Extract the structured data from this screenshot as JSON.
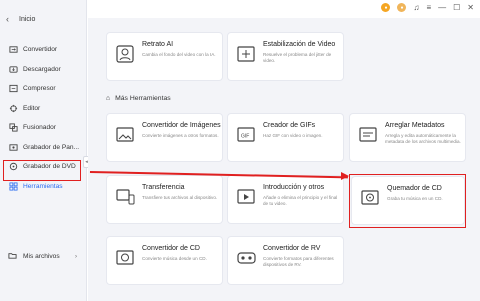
{
  "sidebar": {
    "back_label": "Inicio",
    "items": [
      {
        "label": "Convertidor",
        "icon": "convert-icon"
      },
      {
        "label": "Descargador",
        "icon": "download-icon"
      },
      {
        "label": "Compresor",
        "icon": "compress-icon"
      },
      {
        "label": "Editor",
        "icon": "editor-icon"
      },
      {
        "label": "Fusionador",
        "icon": "merge-icon"
      },
      {
        "label": "Grabador de Pan...",
        "icon": "screen-record-icon"
      },
      {
        "label": "Grabador de DVD",
        "icon": "dvd-icon"
      },
      {
        "label": "Herramientas",
        "icon": "tools-icon"
      }
    ],
    "my_files": "Mis archivos"
  },
  "top_cards": [
    {
      "title": "Retrato AI",
      "desc": "Cambia el fondo del video con la IA."
    },
    {
      "title": "Estabilización de Video",
      "desc": "Resuelve el problema del jitter de video."
    }
  ],
  "section_title": "Más Herramientas",
  "tool_cards": [
    {
      "title": "Convertidor de Imágenes",
      "desc": "Convierte imágenes a otros formatos."
    },
    {
      "title": "Creador de GIFs",
      "desc": "Haz GIF con video o imagen."
    },
    {
      "title": "Arreglar Metadatos",
      "desc": "Arregla y edita automáticamente la metadata de los archivos multimedia."
    },
    {
      "title": "Transferencia",
      "desc": "Transfiere tus archivos al dispositivo."
    },
    {
      "title": "Introducción y otros",
      "desc": "Añade o elimina el principio y el final de tu video."
    },
    {
      "title": "Quemador de CD",
      "desc": "Graba tu música en un CD."
    },
    {
      "title": "Convertidor de CD",
      "desc": "Convierte música desde un CD."
    },
    {
      "title": "Convertidor de RV",
      "desc": "Convierte formatos para diferentes dispositivos de RV."
    }
  ],
  "colors": {
    "accent": "#2a6cf0",
    "highlight": "#e02020"
  }
}
